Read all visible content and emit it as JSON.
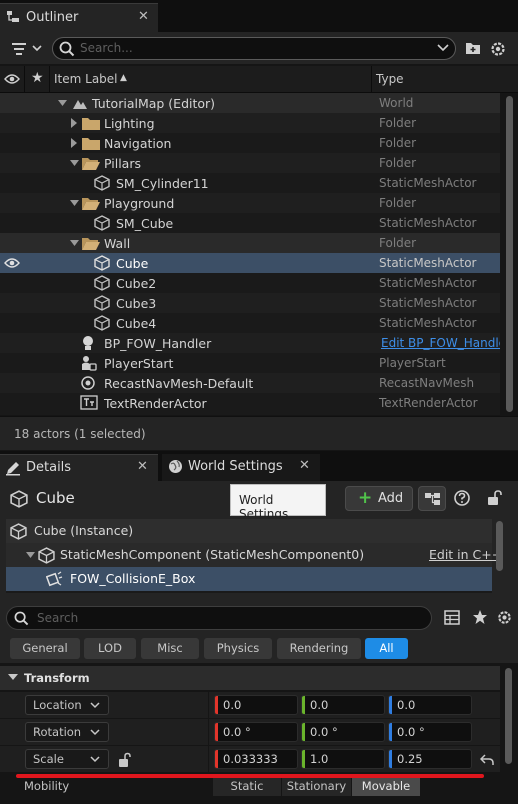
{
  "outliner": {
    "tab_label": "Outliner",
    "close_glyph": "✕",
    "search_placeholder": "Search...",
    "columns": {
      "item_label": "Item Label",
      "sort_glyph": "▲",
      "type": "Type"
    },
    "rows": [
      {
        "label": "TutorialMap (Editor)",
        "type": "World",
        "icon": "world-icon"
      },
      {
        "label": "Lighting",
        "type": "Folder",
        "icon": "folder-icon"
      },
      {
        "label": "Navigation",
        "type": "Folder",
        "icon": "folder-icon"
      },
      {
        "label": "Pillars",
        "type": "Folder",
        "icon": "folder-open-icon"
      },
      {
        "label": "SM_Cylinder11",
        "type": "StaticMeshActor",
        "icon": "static-mesh-icon"
      },
      {
        "label": "Playground",
        "type": "Folder",
        "icon": "folder-open-icon"
      },
      {
        "label": "SM_Cube",
        "type": "StaticMeshActor",
        "icon": "static-mesh-icon"
      },
      {
        "label": "Wall",
        "type": "Folder",
        "icon": "folder-open-icon"
      },
      {
        "label": "Cube",
        "type": "StaticMeshActor",
        "icon": "static-mesh-icon"
      },
      {
        "label": "Cube2",
        "type": "StaticMeshActor",
        "icon": "static-mesh-icon"
      },
      {
        "label": "Cube3",
        "type": "StaticMeshActor",
        "icon": "static-mesh-icon"
      },
      {
        "label": "Cube4",
        "type": "StaticMeshActor",
        "icon": "static-mesh-icon"
      },
      {
        "label": "BP_FOW_Handler",
        "type": "Edit BP_FOW_Handle",
        "icon": "blueprint-actor-icon"
      },
      {
        "label": "PlayerStart",
        "type": "PlayerStart",
        "icon": "player-start-icon"
      },
      {
        "label": "RecastNavMesh-Default",
        "type": "RecastNavMesh",
        "icon": "navmesh-icon"
      },
      {
        "label": "TextRenderActor",
        "type": "TextRenderActor",
        "icon": "text-render-icon"
      }
    ],
    "status": "18 actors (1 selected)"
  },
  "details": {
    "tab_label": "Details",
    "world_settings_tab_label": "World Settings",
    "close_glyph": "✕",
    "title": "Cube",
    "tooltip": "World Settings",
    "add_label": "Add",
    "add_glyph": "+",
    "components": {
      "instance": "Cube (Instance)",
      "mesh_component": "StaticMeshComponent (StaticMeshComponent0)",
      "edit_cpp": "Edit in C++",
      "collision": "FOW_CollisionE_Box"
    },
    "search_placeholder": "Search",
    "filters": [
      "General",
      "LOD",
      "Misc",
      "Physics",
      "Rendering",
      "All"
    ],
    "active_filter": "All",
    "transform": {
      "title": "Transform",
      "location": {
        "label": "Location",
        "x": "0.0",
        "y": "0.0",
        "z": "0.0"
      },
      "rotation": {
        "label": "Rotation",
        "x": "0.0 °",
        "y": "0.0 °",
        "z": "0.0 °"
      },
      "scale": {
        "label": "Scale",
        "x": "0.033333",
        "y": "1.0",
        "z": "0.25"
      },
      "mobility": {
        "label": "Mobility",
        "options": [
          "Static",
          "Stationary",
          "Movable"
        ],
        "selected": "Movable"
      }
    }
  },
  "colors": {
    "selection": "#3c4f66",
    "accent": "#1e8ce6",
    "axis_x": "#e2352b",
    "axis_y": "#6ab42c",
    "axis_z": "#2f7de1",
    "annotation_red": "#e0161d",
    "link": "#3d8ee8"
  }
}
